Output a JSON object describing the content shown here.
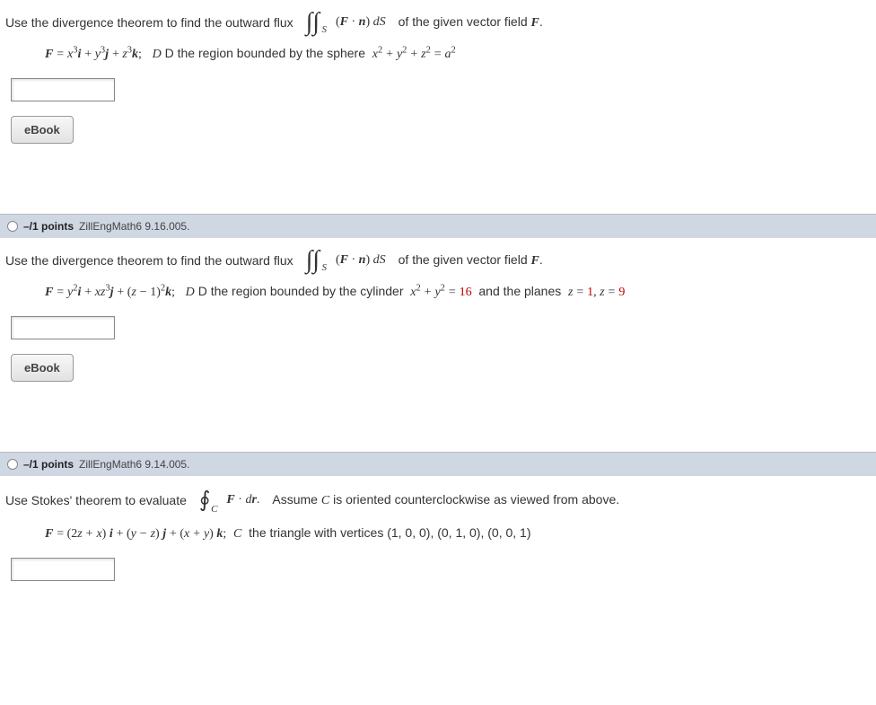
{
  "q1": {
    "prompt_a": "Use the divergence theorem to find the outward flux",
    "integral_sub": "S",
    "prompt_b": "(F · n) dS",
    "prompt_c": "of the given vector field F.",
    "formula_lhs": "F =",
    "formula_rhs_parts": {
      "t1": "x",
      "e1": "3",
      "i": "i",
      "plus1": " + ",
      "t2": "y",
      "e2": "3",
      "j": "j",
      "plus2": " + ",
      "t3": "z",
      "e3": "3",
      "k": "k",
      "semi": ";",
      "region_a": "D the region bounded by the sphere",
      "sphere": "x² + y² + z² = a²"
    },
    "ebook": "eBook"
  },
  "bar2": {
    "points": "–/1 points",
    "ref": "ZillEngMath6 9.16.005."
  },
  "q2": {
    "prompt_a": "Use the divergence theorem to find the outward flux",
    "integral_sub": "S",
    "prompt_b": "(F · n) dS",
    "prompt_c": "of the given vector field F.",
    "formula_lhs": "F =",
    "region_a": "D the region bounded by the cylinder",
    "cyl_lhs": "x² + y² = ",
    "cyl_rhs": "16",
    "region_b": "and the planes",
    "planes_a": "z = ",
    "planes_v1": "1",
    "planes_mid": ", z = ",
    "planes_v2": "9",
    "ebook": "eBook"
  },
  "bar3": {
    "points": "–/1 points",
    "ref": "ZillEngMath6 9.14.005."
  },
  "q3": {
    "prompt_a": "Use Stokes' theorem to evaluate",
    "integral_sub": "C",
    "prompt_b": "F · dr.",
    "prompt_c": "Assume C is oriented counterclockwise as viewed from above.",
    "formula_lhs": "F =",
    "region_a": "C  the triangle with vertices (1, 0, 0), (0, 1, 0), (0, 0, 1)"
  }
}
